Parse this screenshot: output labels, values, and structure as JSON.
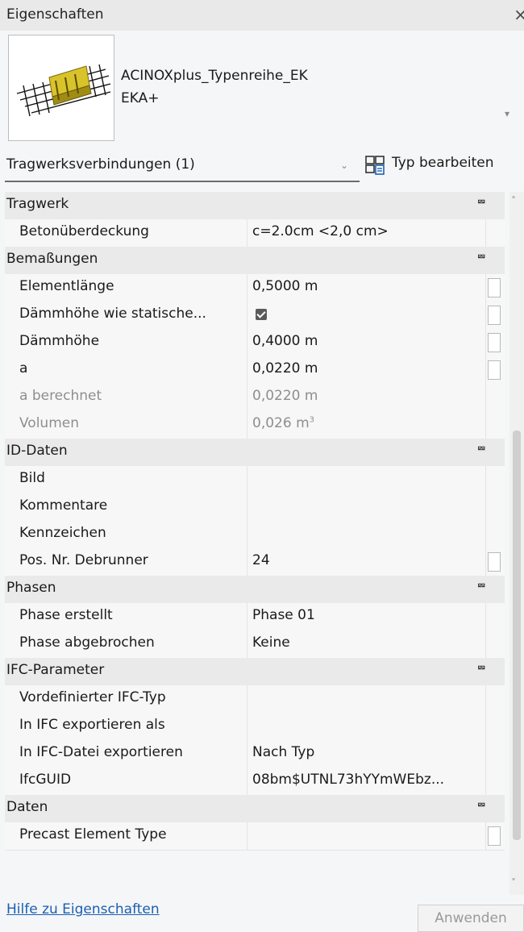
{
  "window": {
    "title": "Eigenschaften",
    "close_glyph": "×"
  },
  "type_selector": {
    "family": "ACINOXplus_Typenreihe_EK",
    "type": "EKA+",
    "thumbnail_icon": "rebar-connector-icon",
    "dropdown_glyph": "▾"
  },
  "instance_bar": {
    "filter_label": "Tragwerksverbindungen (1)",
    "filter_chevron": "⌄",
    "edit_type_label": "Typ bearbeiten",
    "edit_type_icon": "edit-type-icon"
  },
  "collapse_glyph": "⮹",
  "groups": [
    {
      "name": "Tragwerk",
      "rows": [
        {
          "name": "Betonüberdeckung",
          "value": "c=2.0cm <2,0 cm>",
          "assoc": false,
          "readonly": false
        }
      ]
    },
    {
      "name": "Bemaßungen",
      "rows": [
        {
          "name": "Elementlänge",
          "value": "0,5000 m",
          "assoc": true,
          "readonly": false
        },
        {
          "name": "Dämmhöhe wie statische...",
          "value": "",
          "checkbox": true,
          "checked": true,
          "assoc": true,
          "readonly": false
        },
        {
          "name": "Dämmhöhe",
          "value": "0,4000 m",
          "assoc": true,
          "readonly": false
        },
        {
          "name": "a",
          "value": "0,0220 m",
          "assoc": true,
          "readonly": false
        },
        {
          "name": "a berechnet",
          "value": "0,0220 m",
          "assoc": false,
          "readonly": true
        },
        {
          "name": "Volumen",
          "value": "0,026 m",
          "unit_sup": "3",
          "assoc": false,
          "readonly": true
        }
      ]
    },
    {
      "name": "ID-Daten",
      "rows": [
        {
          "name": "Bild",
          "value": "",
          "assoc": false,
          "readonly": false
        },
        {
          "name": "Kommentare",
          "value": "",
          "assoc": false,
          "readonly": false
        },
        {
          "name": "Kennzeichen",
          "value": "",
          "assoc": false,
          "readonly": false
        },
        {
          "name": "Pos. Nr. Debrunner",
          "value": "24",
          "assoc": true,
          "readonly": false
        }
      ]
    },
    {
      "name": "Phasen",
      "rows": [
        {
          "name": "Phase erstellt",
          "value": "Phase 01",
          "assoc": false,
          "readonly": false
        },
        {
          "name": "Phase abgebrochen",
          "value": "Keine",
          "assoc": false,
          "readonly": false
        }
      ]
    },
    {
      "name": "IFC-Parameter",
      "rows": [
        {
          "name": "Vordefinierter IFC-Typ",
          "value": "",
          "assoc": false,
          "readonly": false
        },
        {
          "name": "In IFC exportieren als",
          "value": "",
          "assoc": false,
          "readonly": false
        },
        {
          "name": "In IFC-Datei exportieren",
          "value": "Nach Typ",
          "assoc": false,
          "readonly": false
        },
        {
          "name": "IfcGUID",
          "value": "08bm$UTNL73hYYmWEbz...",
          "assoc": false,
          "readonly": false
        }
      ]
    },
    {
      "name": "Daten",
      "rows": [
        {
          "name": "Precast Element Type",
          "value": "",
          "assoc": true,
          "readonly": false
        }
      ]
    }
  ],
  "scrollbar": {
    "up_glyph": "˄",
    "down_glyph": "˅"
  },
  "footer": {
    "help_link": "Hilfe zu Eigenschaften",
    "apply_label": "Anwenden"
  }
}
